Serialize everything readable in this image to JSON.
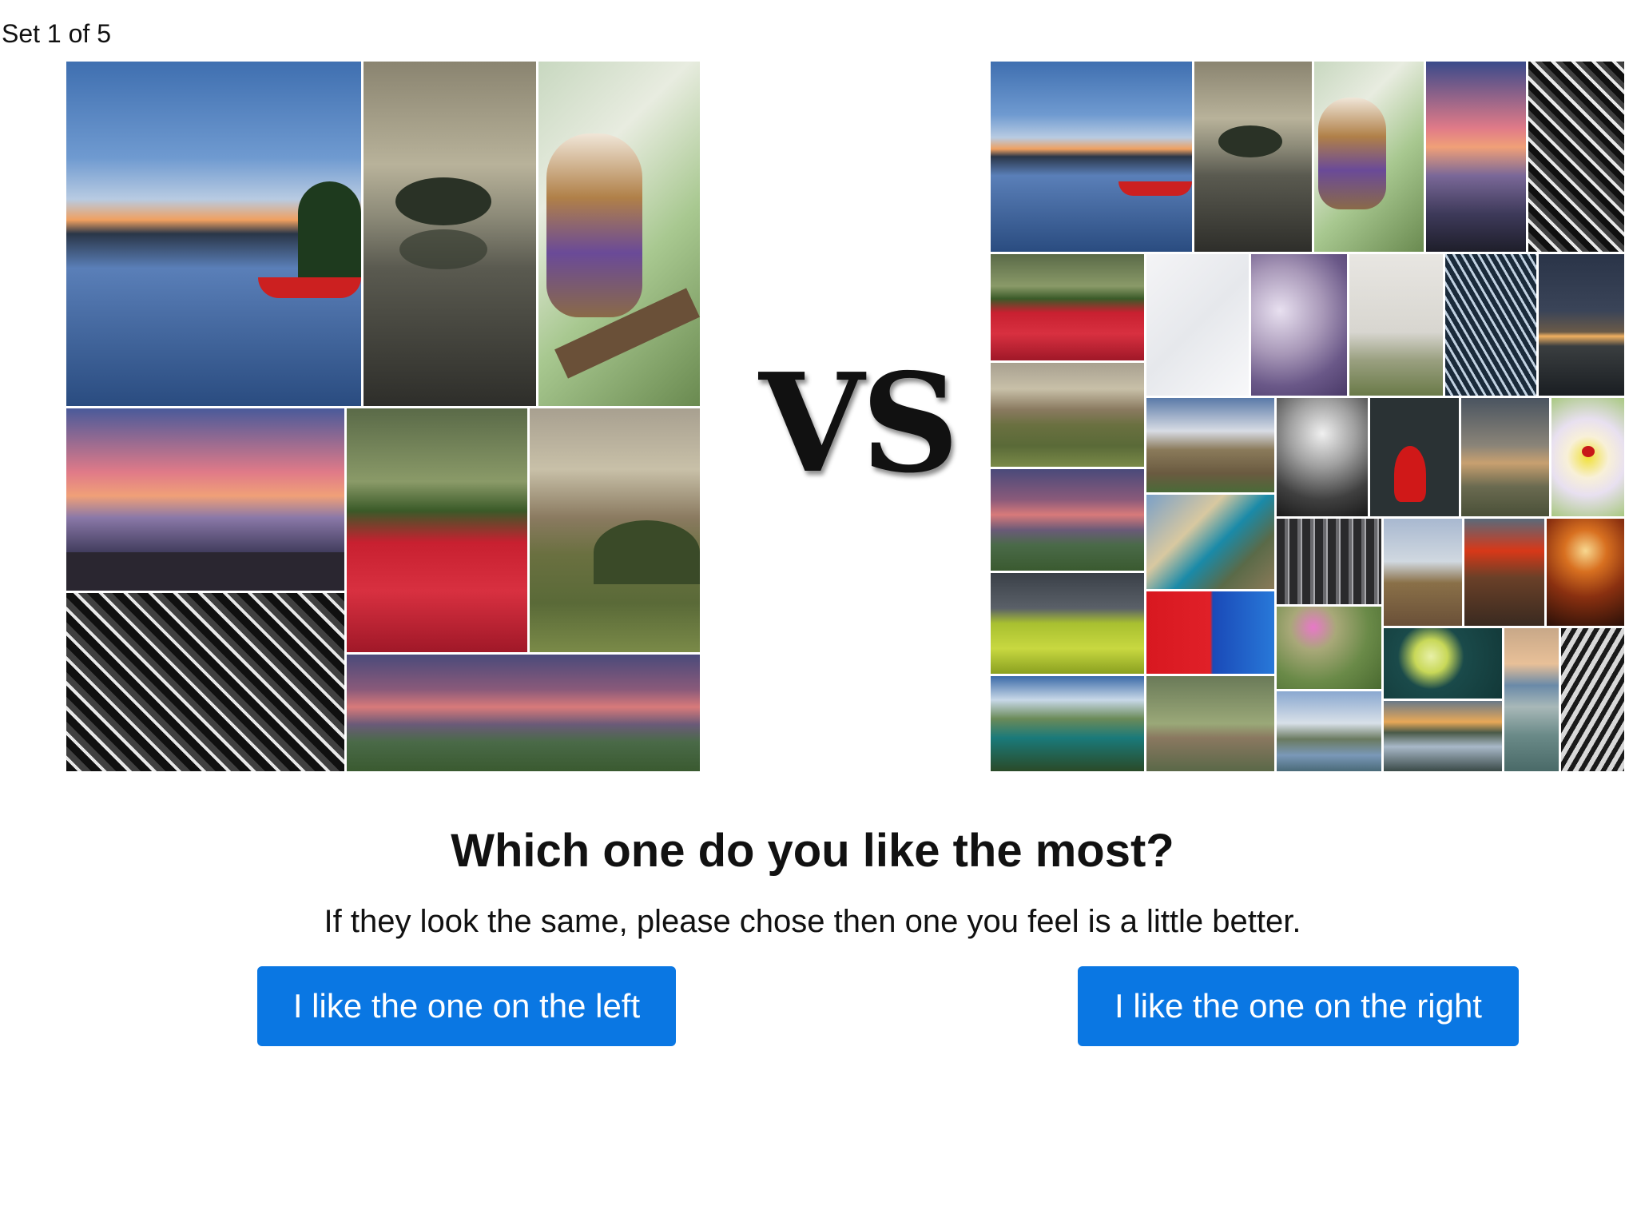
{
  "header": {
    "set_counter": "Set 1 of 5"
  },
  "comparison": {
    "separator": "VS",
    "left_collage": {
      "tiles": [
        "lake-sunset-red-boat",
        "misty-lake-tree-reflection",
        "barn-owl-on-branch",
        "pink-sunset-rocky-shore",
        "red-flowers-forest",
        "rolling-fields-trees",
        "skyscraper-facade",
        "purple-clouds-mountains"
      ]
    },
    "right_collage": {
      "tiles": [
        "lake-sunset-red-boat",
        "misty-lake-tree-reflection",
        "barn-owl-on-branch",
        "pink-sunset-rocky-shore",
        "skyscraper-facade",
        "red-flowers-forest",
        "airplane-sky-white",
        "purple-flowers-bokeh",
        "foggy-meadow",
        "glass-dome-roof",
        "night-lake-stars",
        "rolling-fields-trees",
        "elephant-sculpture",
        "figures-in-fog",
        "red-bird-sculpture",
        "misty-field-sunrise",
        "ladybug-on-flower",
        "purple-clouds-mountains",
        "coastal-highway",
        "dark-pillars",
        "city-cathedral",
        "woman-red-turban",
        "street-lamp-night",
        "green-field-storm",
        "red-door-blue-wall",
        "pink-cyclamen",
        "lime-slice",
        "beach-sunset",
        "zebra-closeup",
        "mountain-lake-aerial",
        "bird-on-branch",
        "windmill-canal",
        "river-sunset-reflection"
      ]
    }
  },
  "prompt": {
    "question": "Which one do you like the most?",
    "hint": "If they look the same, please chose then one you feel is a little better."
  },
  "actions": {
    "left_label": "I like the one on the left",
    "right_label": "I like the one on the right",
    "button_color": "#0a77e3"
  }
}
